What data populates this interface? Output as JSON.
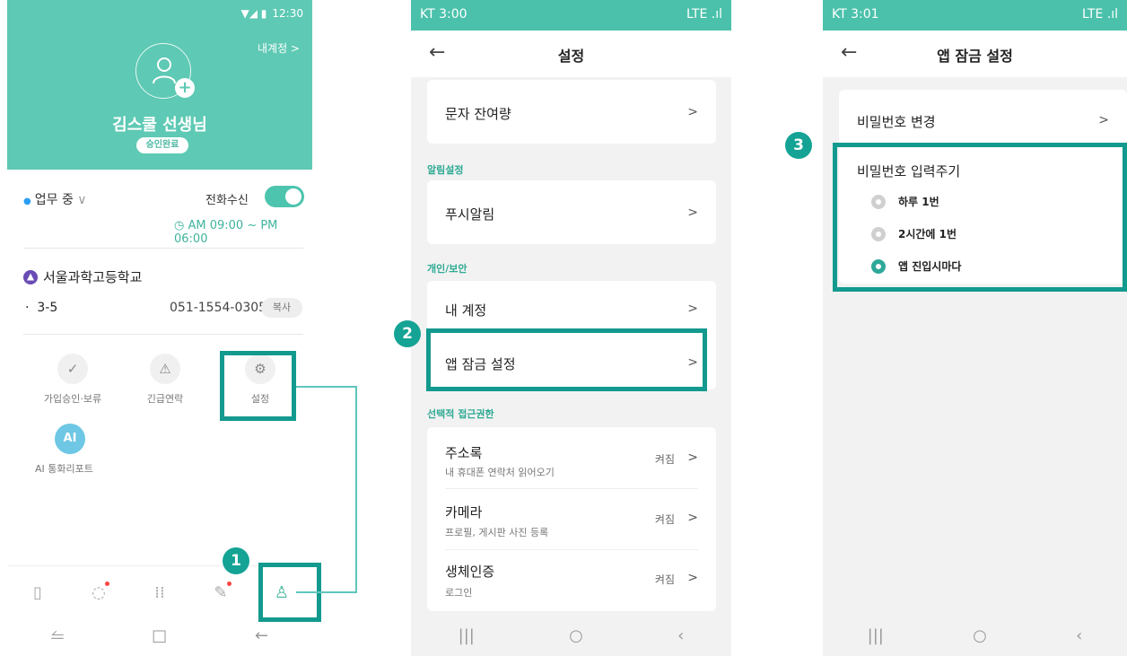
{
  "screen1": {
    "status_time": "12:30",
    "account_link": "내계정 >",
    "teacher_name": "김스쿨 선생님",
    "approval_badge": "승인완료",
    "work_status": "업무 중",
    "call_receive_label": "전화수신",
    "work_hours": "AM 09:00 ~ PM 06:00",
    "school_name": "서울과학고등학교",
    "class_name": "3-5",
    "phone": "051-1554-0305",
    "copy_label": "복사",
    "menu": [
      {
        "label": "가입승인·보류",
        "icon": "check-circle-icon"
      },
      {
        "label": "긴급연락",
        "icon": "siren-icon"
      },
      {
        "label": "설정",
        "icon": "gear-icon"
      },
      {
        "label": "AI 통화리포트",
        "icon": "ai-icon"
      }
    ],
    "bottom_nav": [
      "phone-icon",
      "chat-icon",
      "keypad-icon",
      "pen-icon",
      "profile-icon"
    ]
  },
  "screen2": {
    "status_time": "KT 3:00",
    "status_right": "LTE .ıl",
    "title": "설정",
    "sms_balance": "문자 잔여량",
    "section_alarm": "알림설정",
    "push_alarm": "푸시알림",
    "section_security": "개인/보안",
    "my_account": "내 계정",
    "app_lock": "앱 잠금 설정",
    "section_optional": "선택적 접근권한",
    "permissions": [
      {
        "label": "주소록",
        "sub": "내 휴대폰 연락처 읽어오기",
        "state": "켜짐"
      },
      {
        "label": "카메라",
        "sub": "프로필, 게시판 사진 등록",
        "state": "켜짐"
      },
      {
        "label": "생체인증",
        "sub": "로그인",
        "state": "켜짐"
      }
    ]
  },
  "screen3": {
    "status_time": "KT 3:01",
    "status_right": "LTE .ıl",
    "title": "앱 잠금 설정",
    "change_password": "비밀번호 변경",
    "password_period_title": "비밀번호 입력주기",
    "options": [
      "하루 1번",
      "2시간에 1번",
      "앱 진입시마다"
    ],
    "selected_option": "앱 진입시마다"
  },
  "steps": [
    "1",
    "2",
    "3"
  ],
  "colors": {
    "accent": "#5ec9b4",
    "highlight": "#139a8e",
    "status_bar": "#4bc1ab"
  }
}
